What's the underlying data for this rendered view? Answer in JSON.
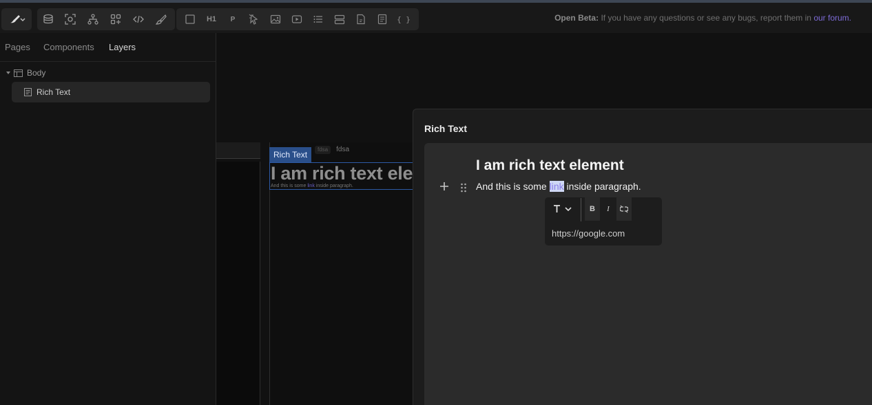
{
  "toolbar": {
    "tools": [
      "logo-brush-icon",
      "database-icon",
      "component-focus-icon",
      "hierarchy-icon",
      "apps-add-icon",
      "code-icon",
      "paint-brush-icon"
    ],
    "elements": {
      "box": "square-icon",
      "heading": "H1",
      "paragraph": "P",
      "link": "link-cursor-icon",
      "image": "image-icon",
      "video": "video-icon",
      "list": "list-icon",
      "stack": "stack-icon",
      "file": "file-icon",
      "richtext": "document-icon",
      "code": "{ }"
    },
    "notice": {
      "label": "Open Beta:",
      "text": "If you have any questions or see any bugs, report them in",
      "link": "our forum."
    }
  },
  "sidebar": {
    "tabs": [
      "Pages",
      "Components",
      "Layers"
    ],
    "active_tab": "Layers",
    "layers": [
      {
        "label": "Body",
        "icon": "table-icon"
      },
      {
        "label": "Rich Text",
        "icon": "document-icon"
      }
    ]
  },
  "canvas": {
    "selection_label": "Rich Text",
    "breadcrumb_tag": "fdsa",
    "breadcrumb": "fdsa",
    "preview_heading": "I am rich text element",
    "preview_para_before": "And this is some",
    "preview_para_link": "link",
    "preview_para_after": "inside paragraph."
  },
  "modal": {
    "title": "Rich Text",
    "heading": "I am rich text element",
    "para_before": "And this is some",
    "para_link": "link",
    "para_after": "inside paragraph.",
    "popover": {
      "url": "https://google.com",
      "tools": [
        "text-type-icon",
        "bold-icon",
        "italic-icon",
        "unlink-icon"
      ]
    }
  },
  "colors": {
    "accent": "#7d6bd6",
    "selection": "#2a4f8a",
    "background": "#111111"
  }
}
